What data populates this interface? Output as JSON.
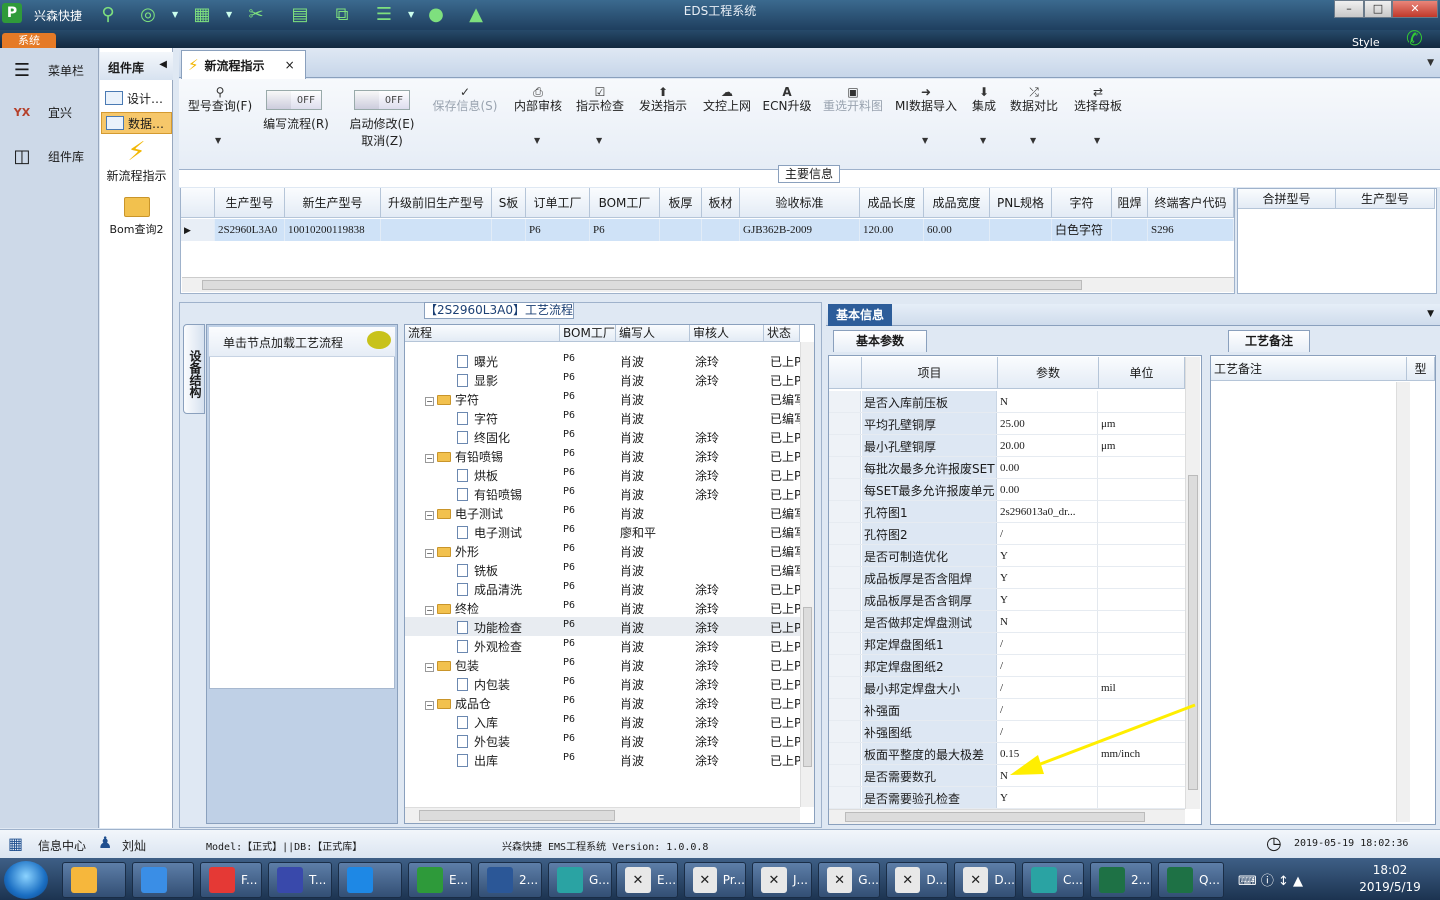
{
  "app": {
    "title": "EDS工程系统",
    "name": "兴森快捷",
    "system_tab": "系统",
    "style_label": "Style",
    "colors": {
      "accent": "#2d5d9a",
      "selected_row": "#cfe2f7",
      "annotation_arrow": "#ffee00"
    }
  },
  "window_controls": {
    "minimize": "–",
    "maximize": "□",
    "close": "✕"
  },
  "top_toolbar_icons": [
    "logo-icon",
    "search-icon",
    "target-icon",
    "grid-icon",
    "scissors-icon",
    "film-icon",
    "copy-icon",
    "list-icon",
    "user-icon",
    "chart-icon"
  ],
  "left_nav": {
    "items": [
      {
        "label": "菜单栏",
        "icon": "menu-icon"
      },
      {
        "label": "宜兴",
        "icon": "factory-icon"
      },
      {
        "label": "组件库",
        "icon": "calculator-icon"
      }
    ]
  },
  "library": {
    "header": "组件库",
    "items": [
      {
        "label": "设计…"
      },
      {
        "label": "数据…"
      }
    ],
    "big_items": [
      {
        "label": "新流程指示",
        "icon": "lightning-icon"
      },
      {
        "label": "Bom查询2",
        "icon": "folder-icon"
      }
    ]
  },
  "tabs": [
    {
      "label": "新流程指示",
      "close": "×"
    }
  ],
  "ribbon": {
    "buttons": [
      {
        "label": "型号查询(F)",
        "icon": "search-icon"
      },
      {
        "label": "编写流程(R)",
        "toggle": "OFF"
      },
      {
        "label": "启动修改(E)",
        "label2": "取消(Z)",
        "toggle": "OFF"
      },
      {
        "label": "保存信息(S)",
        "icon": "check-icon",
        "disabled": true
      },
      {
        "label": "内部审核",
        "icon": "print-icon"
      },
      {
        "label": "指示检查",
        "icon": "checkbox-icon"
      },
      {
        "label": "发送指示",
        "icon": "upload-icon"
      },
      {
        "label": "文控上网",
        "icon": "cloud-upload-icon"
      },
      {
        "label": "ECN升级",
        "icon": "text-a-icon"
      },
      {
        "label": "重选开料图",
        "icon": "image-icon",
        "disabled": true
      },
      {
        "label": "MI数据导入",
        "icon": "import-icon"
      },
      {
        "label": "集成",
        "icon": "download-icon"
      },
      {
        "label": "数据对比",
        "icon": "compare-icon"
      },
      {
        "label": "选择母板",
        "icon": "shuffle-icon"
      }
    ]
  },
  "main_info": {
    "label": "主要信息",
    "columns": [
      "生产型号",
      "新生产型号",
      "升级前旧生产型号",
      "S板",
      "订单工厂",
      "BOM工厂",
      "板厚",
      "板材",
      "验收标准",
      "成品长度",
      "成品宽度",
      "PNL规格",
      "字符",
      "阻焊",
      "终端客户代码"
    ],
    "row": [
      "2S2960L3A0",
      "10010200119838",
      "",
      "",
      "P6",
      "P6",
      "",
      "",
      "GJB362B-2009",
      "120.00",
      "60.00",
      "",
      "白色字符",
      "",
      "S296"
    ],
    "right_columns": [
      "合拼型号",
      "生产型号"
    ]
  },
  "process": {
    "title": "【2S2960L3A0】工艺流程",
    "side_tab": "设备结构",
    "card_hint": "单击节点加载工艺流程",
    "columns": [
      "流程",
      "BOM工厂",
      "编写人",
      "审核人",
      "状态"
    ],
    "rows": [
      {
        "name": "曝光",
        "level": 2,
        "factory": "P6",
        "writer": "肖波",
        "reviewer": "涂玲",
        "status": "已上P"
      },
      {
        "name": "显影",
        "level": 2,
        "factory": "P6",
        "writer": "肖波",
        "reviewer": "涂玲",
        "status": "已上P"
      },
      {
        "name": "字符",
        "level": 1,
        "factory": "P6",
        "writer": "肖波",
        "reviewer": "",
        "status": "已编写"
      },
      {
        "name": "字符",
        "level": 2,
        "factory": "P6",
        "writer": "肖波",
        "reviewer": "",
        "status": "已编写"
      },
      {
        "name": "终固化",
        "level": 2,
        "factory": "P6",
        "writer": "肖波",
        "reviewer": "涂玲",
        "status": "已上P"
      },
      {
        "name": "有铅喷锡",
        "level": 1,
        "factory": "P6",
        "writer": "肖波",
        "reviewer": "涂玲",
        "status": "已上P"
      },
      {
        "name": "烘板",
        "level": 2,
        "factory": "P6",
        "writer": "肖波",
        "reviewer": "涂玲",
        "status": "已上P"
      },
      {
        "name": "有铅喷锡",
        "level": 2,
        "factory": "P6",
        "writer": "肖波",
        "reviewer": "涂玲",
        "status": "已上P"
      },
      {
        "name": "电子测试",
        "level": 1,
        "factory": "P6",
        "writer": "肖波",
        "reviewer": "",
        "status": "已编写"
      },
      {
        "name": "电子测试",
        "level": 2,
        "factory": "P6",
        "writer": "廖和平",
        "reviewer": "",
        "status": "已编写"
      },
      {
        "name": "外形",
        "level": 1,
        "factory": "P6",
        "writer": "肖波",
        "reviewer": "",
        "status": "已编写"
      },
      {
        "name": "铣板",
        "level": 2,
        "factory": "P6",
        "writer": "肖波",
        "reviewer": "",
        "status": "已编写"
      },
      {
        "name": "成品清洗",
        "level": 2,
        "factory": "P6",
        "writer": "肖波",
        "reviewer": "涂玲",
        "status": "已上P"
      },
      {
        "name": "终检",
        "level": 1,
        "factory": "P6",
        "writer": "肖波",
        "reviewer": "涂玲",
        "status": "已上P"
      },
      {
        "name": "功能检查",
        "level": 2,
        "factory": "P6",
        "writer": "肖波",
        "reviewer": "涂玲",
        "status": "已上P",
        "selected": true
      },
      {
        "name": "外观检查",
        "level": 2,
        "factory": "P6",
        "writer": "肖波",
        "reviewer": "涂玲",
        "status": "已上P"
      },
      {
        "name": "包装",
        "level": 1,
        "factory": "P6",
        "writer": "肖波",
        "reviewer": "涂玲",
        "status": "已上P"
      },
      {
        "name": "内包装",
        "level": 2,
        "factory": "P6",
        "writer": "肖波",
        "reviewer": "涂玲",
        "status": "已上P"
      },
      {
        "name": "成品仓",
        "level": 1,
        "factory": "P6",
        "writer": "肖波",
        "reviewer": "涂玲",
        "status": "已上P"
      },
      {
        "name": "入库",
        "level": 2,
        "factory": "P6",
        "writer": "肖波",
        "reviewer": "涂玲",
        "status": "已上P"
      },
      {
        "name": "外包装",
        "level": 2,
        "factory": "P6",
        "writer": "肖波",
        "reviewer": "涂玲",
        "status": "已上P"
      },
      {
        "name": "出库",
        "level": 2,
        "factory": "P6",
        "writer": "肖波",
        "reviewer": "涂玲",
        "status": "已上P"
      }
    ]
  },
  "basic_info": {
    "tab": "基本信息",
    "subtab": "基本参数",
    "columns": [
      "项目",
      "参数",
      "单位"
    ],
    "rows": [
      {
        "item": "是否入库前压板",
        "value": "N",
        "unit": ""
      },
      {
        "item": "平均孔壁铜厚",
        "value": "25.00",
        "unit": "μm"
      },
      {
        "item": "最小孔壁铜厚",
        "value": "20.00",
        "unit": "μm"
      },
      {
        "item": "每批次最多允许报废SET",
        "value": "0.00",
        "unit": ""
      },
      {
        "item": "每SET最多允许报废单元",
        "value": "0.00",
        "unit": ""
      },
      {
        "item": "孔符图1",
        "value": "2s296013a0_dr...",
        "unit": ""
      },
      {
        "item": "孔符图2",
        "value": "/",
        "unit": ""
      },
      {
        "item": "是否可制造优化",
        "value": "Y",
        "unit": ""
      },
      {
        "item": "成品板厚是否含阻焊",
        "value": "Y",
        "unit": ""
      },
      {
        "item": "成品板厚是否含铜厚",
        "value": "Y",
        "unit": ""
      },
      {
        "item": "是否做邦定焊盘测试",
        "value": "N",
        "unit": ""
      },
      {
        "item": "邦定焊盘图纸1",
        "value": "/",
        "unit": ""
      },
      {
        "item": "邦定焊盘图纸2",
        "value": "/",
        "unit": ""
      },
      {
        "item": "最小邦定焊盘大小",
        "value": "/",
        "unit": "mil"
      },
      {
        "item": "补强面",
        "value": "/",
        "unit": ""
      },
      {
        "item": "补强图纸",
        "value": "/",
        "unit": ""
      },
      {
        "item": "板面平整度的最大极差",
        "value": "0.15",
        "unit": "mm/inch"
      },
      {
        "item": "是否需要数孔",
        "value": "N",
        "unit": ""
      },
      {
        "item": "是否需要验孔检查",
        "value": "Y",
        "unit": ""
      }
    ]
  },
  "notes": {
    "tab": "工艺备注",
    "columns": [
      "工艺备注",
      "型"
    ]
  },
  "status": {
    "info_center": "信息中心",
    "user": "刘灿",
    "model": "Model:【正式】||DB:【正式库】",
    "version": "兴森快捷 EMS工程系统 Version: 1.0.0.8",
    "datetime": "2019-05-19 18:02:36"
  },
  "taskbar": {
    "buttons": [
      {
        "label": "",
        "icon": "shell-icon",
        "bg": "#f6b73c"
      },
      {
        "label": "",
        "icon": "ie-icon",
        "bg": "#3a8ee6"
      },
      {
        "label": "F...",
        "icon": "foxmail-icon",
        "bg": "#e53935"
      },
      {
        "label": "T...",
        "icon": "save-icon",
        "bg": "#3949ab"
      },
      {
        "label": "",
        "icon": "send-icon",
        "bg": "#1e88e5"
      },
      {
        "label": "E...",
        "icon": "eds-icon",
        "bg": "#2e9a3a"
      },
      {
        "label": "2...",
        "icon": "word-icon",
        "bg": "#2b5797"
      },
      {
        "label": "G...",
        "icon": "eye-icon",
        "bg": "#2aa3a3"
      },
      {
        "label": "E...",
        "icon": "x-window-icon",
        "bg": "#e8e8e8"
      },
      {
        "label": "Pr...",
        "icon": "x-window-icon",
        "bg": "#e8e8e8"
      },
      {
        "label": "J...",
        "icon": "x-window-icon",
        "bg": "#e8e8e8"
      },
      {
        "label": "G...",
        "icon": "x-window-icon",
        "bg": "#e8e8e8"
      },
      {
        "label": "D...",
        "icon": "x-window-icon",
        "bg": "#e8e8e8"
      },
      {
        "label": "D...",
        "icon": "x-window-icon",
        "bg": "#e8e8e8"
      },
      {
        "label": "C...",
        "icon": "eye-icon",
        "bg": "#2aa3a3"
      },
      {
        "label": "2...",
        "icon": "excel-icon",
        "bg": "#1e7145"
      },
      {
        "label": "Q...",
        "icon": "excel-icon",
        "bg": "#1e7145"
      }
    ],
    "time": "18:02",
    "date": "2019/5/19"
  }
}
